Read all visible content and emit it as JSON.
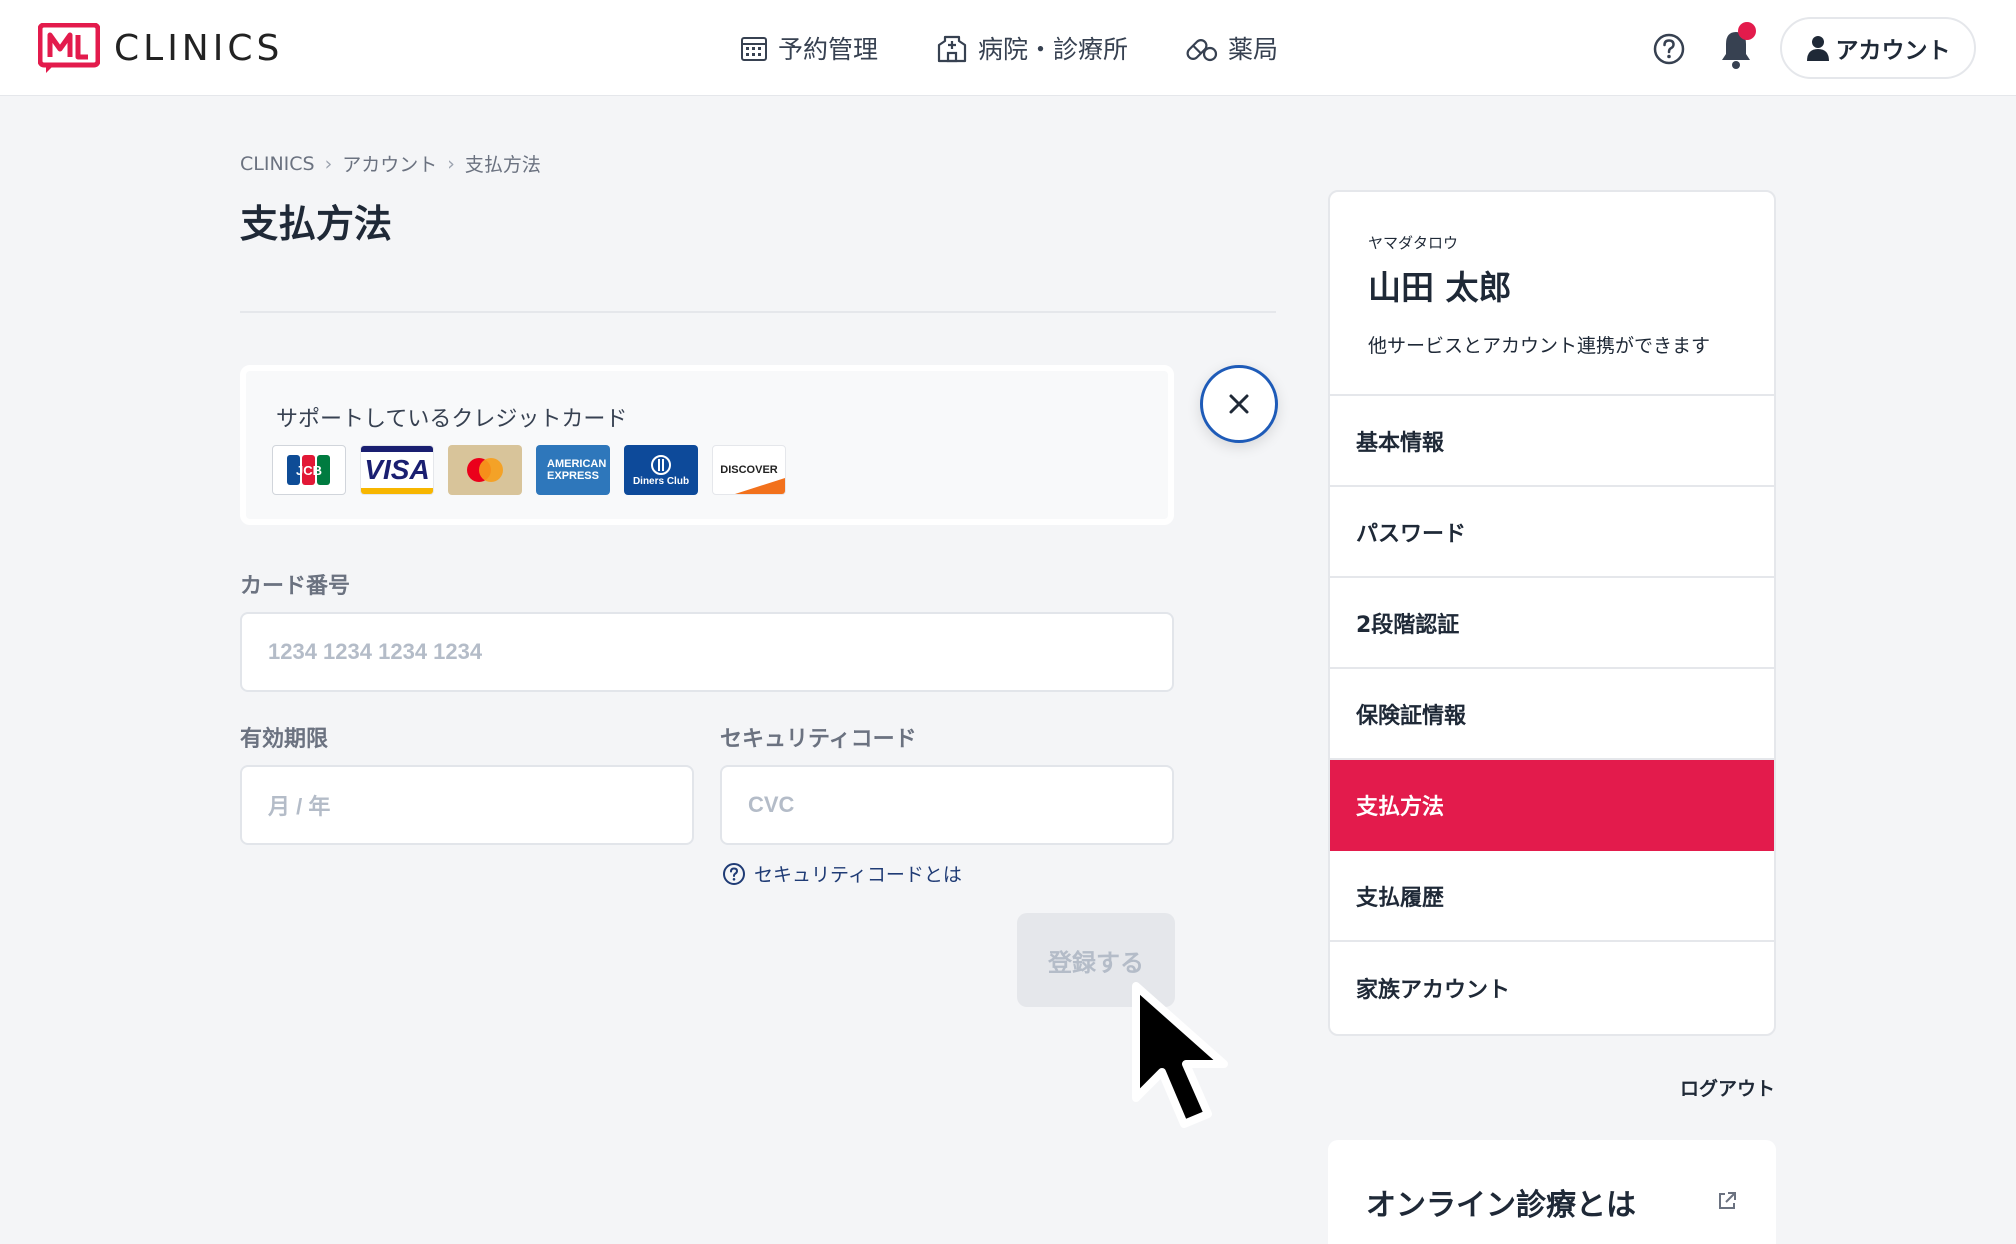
{
  "header": {
    "brand": "CLINICS",
    "nav": [
      {
        "label": "予約管理",
        "icon": "calendar-icon"
      },
      {
        "label": "病院・診療所",
        "icon": "hospital-icon"
      },
      {
        "label": "薬局",
        "icon": "pill-icon"
      }
    ],
    "account_label": "アカウント",
    "notification_dot_color": "#e31b4c"
  },
  "breadcrumb": [
    "CLINICS",
    "アカウント",
    "支払方法"
  ],
  "page_title": "支払方法",
  "supported_cards": {
    "label": "サポートしているクレジットカード",
    "brands": [
      "JCB",
      "VISA",
      "Mastercard",
      "American Express",
      "Diners Club",
      "DISCOVER"
    ],
    "logo_text": {
      "visa": "VISA",
      "amex": "AMERICAN EXPRESS",
      "diners": "Diners Club",
      "discover": "DISCOVER"
    }
  },
  "form": {
    "card_number_label": "カード番号",
    "card_number_placeholder": "1234 1234 1234 1234",
    "expiry_label": "有効期限",
    "expiry_placeholder": "月 / 年",
    "cvc_label": "セキュリティコード",
    "cvc_placeholder": "CVC",
    "cvc_help": "セキュリティコードとは",
    "submit_label": "登録する"
  },
  "sidebar": {
    "kana": "ヤマダタロウ",
    "name": "山田 太郎",
    "link_note": "他サービスとアカウント連携ができます",
    "menu": [
      "基本情報",
      "パスワード",
      "2段階認証",
      "保険証情報",
      "支払方法",
      "支払履歴",
      "家族アカウント"
    ],
    "active_item": "支払方法",
    "logout": "ログアウト",
    "promo_title": "オンライン診療とは"
  },
  "colors": {
    "accent": "#e31b4c",
    "link": "#1f3b75",
    "close_ring": "#1e5bb8"
  }
}
